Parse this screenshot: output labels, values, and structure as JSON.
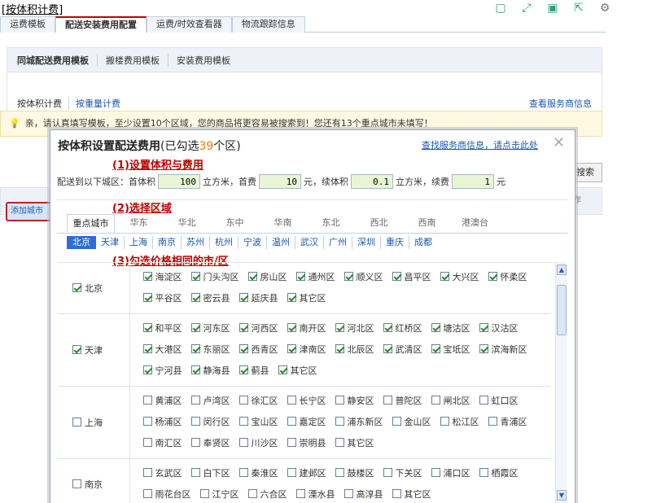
{
  "doc_title": "[按体积计费]",
  "top_icons": [
    "fullscreen-icon",
    "expand-icon",
    "save-icon",
    "share-icon",
    "settings-icon"
  ],
  "main_tabs": [
    "运费模板",
    "配送安装费用配置",
    "运费/时效查看器",
    "物流跟踪信息"
  ],
  "sub_tabs": [
    "同城配送费用模板",
    "搬楼费用模板",
    "安装费用模板"
  ],
  "charge_types": [
    "按体积计费",
    "按重量计费"
  ],
  "service_link": "查看服务商信息",
  "notice": "亲，请认真填写模板，至少设置10个区域，您的商品将更容易被搜索到！您还有13个重点城市未填写！",
  "left_button": "添加城市",
  "right_button": "搜索",
  "right_cell": "作",
  "modal": {
    "title_prefix": "按体积设置配送费用",
    "title_open": "(已勾选",
    "selected_count": "39",
    "title_close": "个区)",
    "service_link": "查找服务商信息，请点击此处",
    "close": "✕",
    "step1": "(1)设置体积与费用",
    "step2": "(2)选择区域",
    "step3": "(3)勾选价格相同的市/区",
    "fee": {
      "label": "配送到以下城区：首体积",
      "first_volume": "100",
      "unit1": "立方米，首费",
      "first_fee": "10",
      "unit2": "元，续体积",
      "extra_volume": "0.1",
      "unit3": "立方米，续费",
      "extra_fee": "1",
      "unit4": "元"
    },
    "region_tabs": [
      "重点城市",
      "华东",
      "华北",
      "东中",
      "华南",
      "东北",
      "西北",
      "西南",
      "港澳台"
    ],
    "city_tabs": [
      "北京",
      "天津",
      "上海",
      "南京",
      "苏州",
      "杭州",
      "宁波",
      "温州",
      "武汉",
      "广州",
      "深圳",
      "重庆",
      "成都"
    ],
    "cities": [
      {
        "name": "北京",
        "checked": true,
        "districts": [
          "海淀区",
          "门头沟区",
          "房山区",
          "通州区",
          "顺义区",
          "昌平区",
          "大兴区",
          "怀柔区",
          "平谷区",
          "密云县",
          "延庆县",
          "其它区"
        ]
      },
      {
        "name": "天津",
        "checked": true,
        "districts": [
          "和平区",
          "河东区",
          "河西区",
          "南开区",
          "河北区",
          "红桥区",
          "塘沽区",
          "汉沽区",
          "大港区",
          "东丽区",
          "西青区",
          "津南区",
          "北辰区",
          "武清区",
          "宝坻区",
          "滨海新区",
          "宁河县",
          "静海县",
          "蓟县",
          "其它区"
        ]
      },
      {
        "name": "上海",
        "checked": false,
        "districts": [
          "黄浦区",
          "卢湾区",
          "徐汇区",
          "长宁区",
          "静安区",
          "普陀区",
          "闸北区",
          "虹口区",
          "杨浦区",
          "闵行区",
          "宝山区",
          "嘉定区",
          "浦东新区",
          "金山区",
          "松江区",
          "青浦区",
          "南汇区",
          "奉贤区",
          "川沙区",
          "崇明县",
          "其它区"
        ]
      },
      {
        "name": "南京",
        "checked": false,
        "districts": [
          "玄武区",
          "白下区",
          "秦淮区",
          "建邺区",
          "鼓楼区",
          "下关区",
          "浦口区",
          "栖霞区",
          "雨花台区",
          "江宁区",
          "六合区",
          "溧水县",
          "高淳县",
          "其它区"
        ]
      }
    ]
  }
}
